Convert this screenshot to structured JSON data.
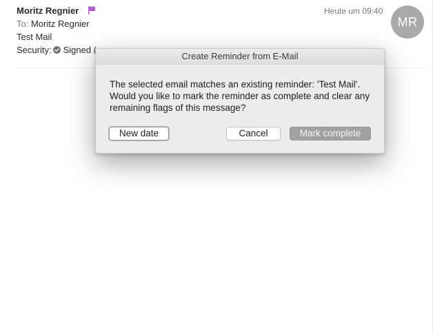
{
  "message": {
    "sender": "Moritz Regnier",
    "datetime": "Heute um 09:40",
    "avatar_initials": "MR",
    "to_label": "To:",
    "to_name": "Moritz Regnier",
    "subject": "Test Mail",
    "security_label": "Security:",
    "security_value": "Signed (",
    "flag_color": "#b35bd6"
  },
  "dialog": {
    "title": "Create Reminder from E-Mail",
    "text": "The selected email matches an existing reminder: 'Test Mail'. Would you like to mark the reminder as complete and clear any remaining flags of this message?",
    "buttons": {
      "new_date": "New date",
      "cancel": "Cancel",
      "mark_complete": "Mark complete"
    }
  }
}
